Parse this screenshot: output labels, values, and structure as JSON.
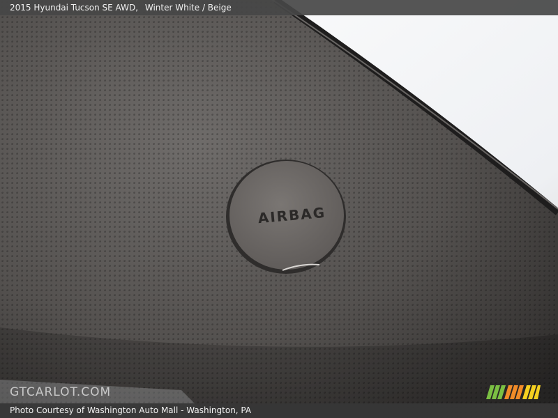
{
  "caption": {
    "vehicle": "2015 Hyundai Tucson SE AWD,",
    "color": "Winter White / Beige"
  },
  "photo": {
    "emblem_text": "AIRBAG"
  },
  "watermark": {
    "text": "GTCARLOT.COM"
  },
  "credit": {
    "text": "Photo Courtesy of Washington Auto Mall - Washington, PA"
  },
  "colors": {
    "panel_dark": "#3e3c3b",
    "panel_mid": "#6b6866",
    "window_light": "#f4f5f7",
    "logo_green": "#7bc043",
    "logo_orange": "#f28c28",
    "logo_yellow": "#f5d020"
  }
}
